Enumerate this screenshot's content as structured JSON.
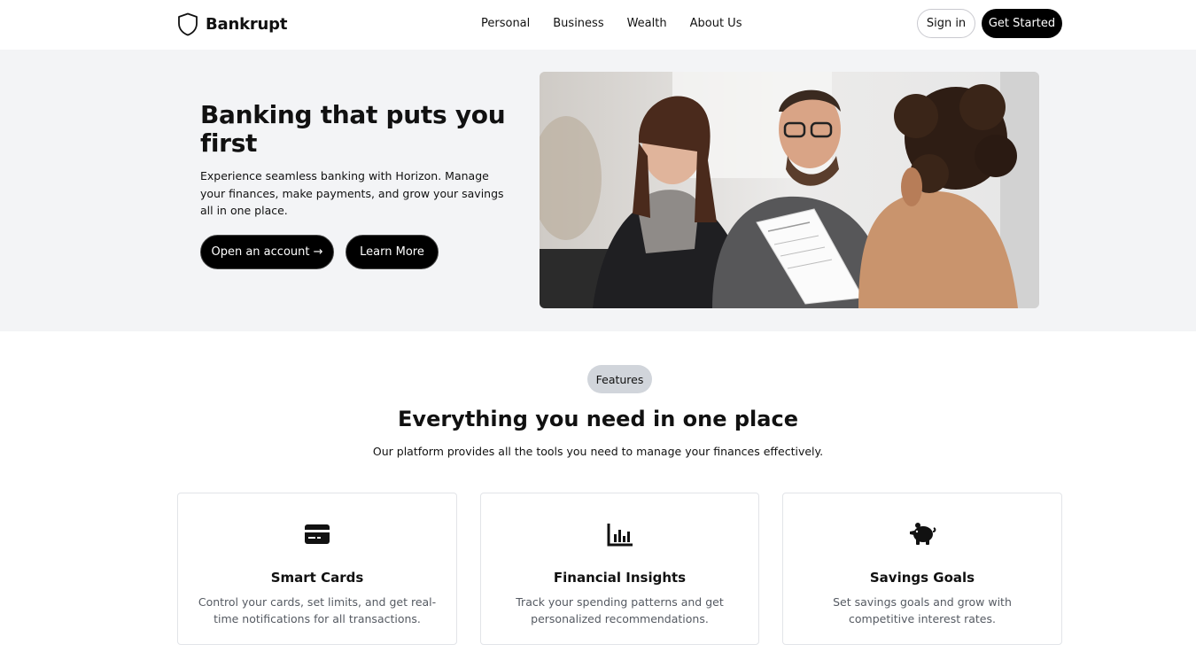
{
  "brand": {
    "name": "Bankrupt",
    "logo_icon": "shield-icon"
  },
  "nav": {
    "items": [
      {
        "label": "Personal"
      },
      {
        "label": "Business"
      },
      {
        "label": "Wealth"
      },
      {
        "label": "About Us"
      }
    ],
    "signin_label": "Sign in",
    "get_started_label": "Get Started"
  },
  "hero": {
    "title": "Banking that puts you first",
    "description": "Experience seamless banking with Horizon. Manage your finances, make payments, and grow your savings all in one place.",
    "primary_button": "Open an account →",
    "secondary_button": "Learn More",
    "image_alt": "Three people smiling at a table reviewing a document"
  },
  "features": {
    "badge": "Features",
    "title": "Everything you need in one place",
    "subtitle": "Our platform provides all the tools you need to manage your finances effectively.",
    "cards": [
      {
        "icon": "credit-card-icon",
        "title": "Smart Cards",
        "text": "Control your cards, set limits, and get real-time notifications for all transactions."
      },
      {
        "icon": "bar-chart-icon",
        "title": "Financial Insights",
        "text": "Track your spending patterns and get personalized recommendations."
      },
      {
        "icon": "piggy-bank-icon",
        "title": "Savings Goals",
        "text": "Set savings goals and grow with competitive interest rates."
      }
    ]
  },
  "colors": {
    "primary": "#000000",
    "hero_bg": "#f3f4f6",
    "badge_bg": "#d1d5db",
    "muted_text": "#555a62",
    "border": "#e2e4e8"
  }
}
